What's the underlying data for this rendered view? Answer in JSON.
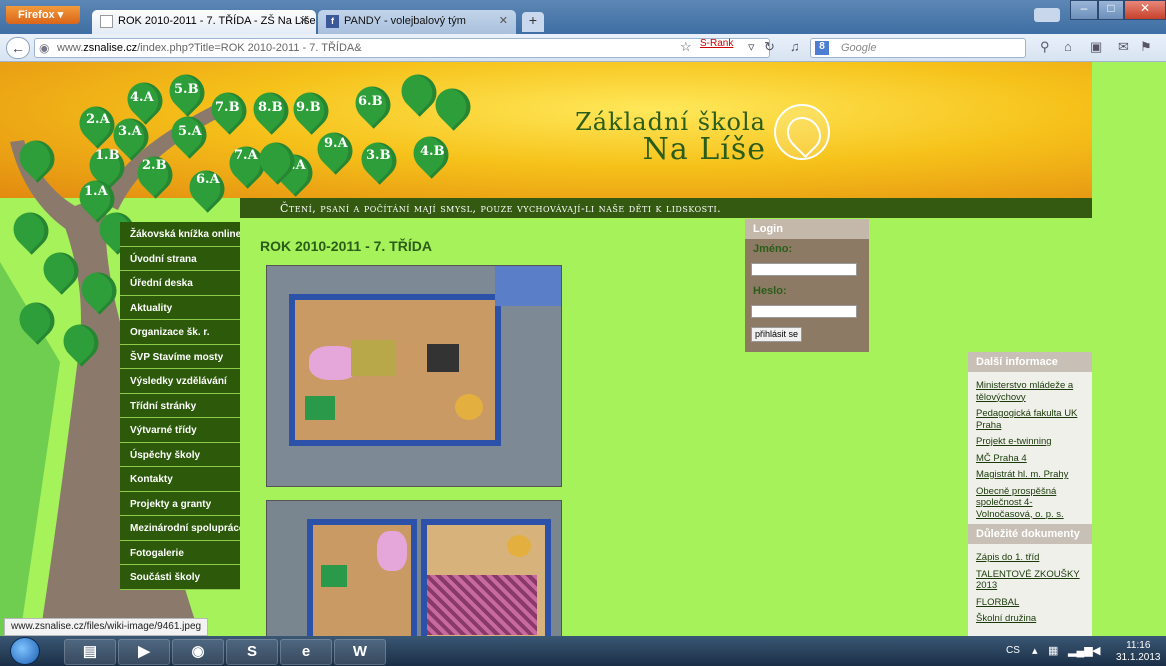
{
  "browser": {
    "menu_button": "Firefox",
    "tabs": [
      {
        "title": "ROK 2010-2011 - 7. TŘÍDA - ZŠ Na Líše",
        "active": true
      },
      {
        "title": "PANDY - volejbalový tým",
        "active": false
      }
    ],
    "new_tab": "+",
    "url_prefix": "www.",
    "url_domain": "zsnalise.cz",
    "url_rest": "/index.php?Title=ROK 2010-2011 - 7. TŘÍDA&",
    "srank_label": "S-Rank",
    "search_engine": "Google",
    "status_link": "www.zsnalise.cz/files/wiki-image/9461.jpeg"
  },
  "header": {
    "school_line1": "Základní škola",
    "school_line2": "Na Líše",
    "motto": "Čtení, psaní a počítání mají smysl, pouze vychovávají-li naše děti k lidskosti.",
    "class_leaves": [
      "4.A",
      "5.B",
      "2.A",
      "3.A",
      "5.A",
      "7.B",
      "8.B",
      "9.B",
      "6.B",
      "1.B",
      "2.B",
      "6.A",
      "7.A",
      "8.A",
      "9.A",
      "3.B",
      "4.B",
      "1.A"
    ]
  },
  "menu": {
    "items": [
      "Žákovská knížka online",
      "Úvodní strana",
      "Úřední deska",
      "Aktuality",
      "Organizace šk. r.",
      "ŠVP Stavíme mosty",
      "Výsledky vzdělávání",
      "Třídní stránky",
      "Výtvarné třídy",
      "Úspěchy školy",
      "Kontakty",
      "Projekty a granty",
      "Mezinárodní spolupráce",
      "Fotogalerie",
      "Součásti školy"
    ]
  },
  "content": {
    "title": "ROK 2010-2011 - 7. TŘÍDA"
  },
  "login": {
    "heading": "Login",
    "username_label": "Jméno:",
    "password_label": "Heslo:",
    "submit": "přihlásit se"
  },
  "sidebar": {
    "more_info_heading": "Další informace",
    "more_info_links": [
      "Ministerstvo mládeže a tělovýchovy",
      "Pedagogická fakulta UK Praha",
      "Projekt e-twinning",
      "MČ Praha 4",
      "Magistrát hl. m. Prahy",
      "Obecně prospěšná společnost 4-Volnočasová, o. p. s."
    ],
    "documents_heading": "Důležité dokumenty",
    "documents_links": [
      "Zápis do 1. tříd",
      "TALENTOVÉ ZKOUŠKY 2013",
      "FLORBAL",
      "Školní družina"
    ]
  },
  "taskbar": {
    "language": "CS",
    "time": "11:16",
    "date": "31.1.2013"
  },
  "colors": {
    "page_bg": "#a6f25a",
    "menu_bg": "#2c5a0a",
    "title_green": "#2b5d1a",
    "login_bg": "#8d7a64"
  }
}
